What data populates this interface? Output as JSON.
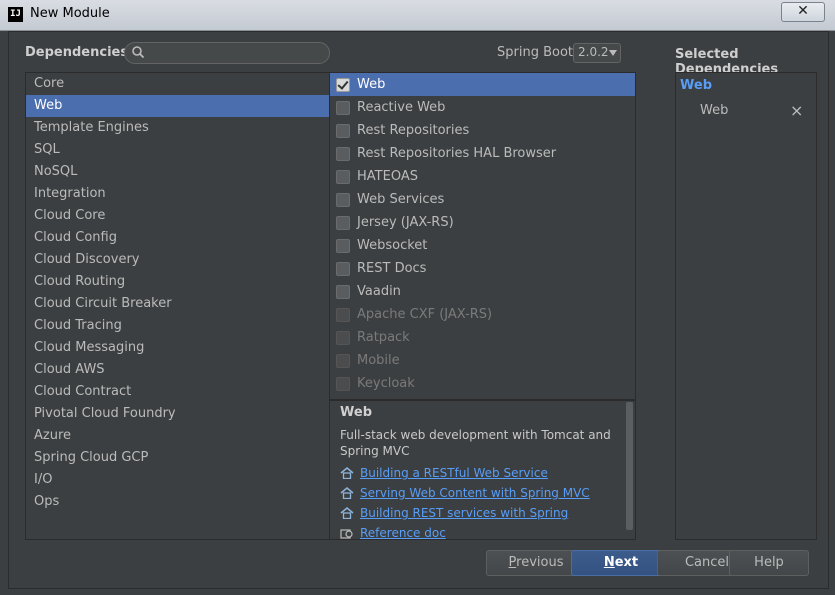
{
  "window": {
    "title": "New Module",
    "close_glyph": "✕",
    "app_icon": "IJ"
  },
  "header": {
    "dependencies_label": "Dependencies",
    "search": {
      "value": "",
      "placeholder": ""
    },
    "spring_boot_label": "Spring Boot",
    "spring_boot_version": "2.0.2",
    "selected_label": "Selected Dependencies"
  },
  "categories": [
    {
      "label": "Core"
    },
    {
      "label": "Web",
      "selected": true
    },
    {
      "label": "Template Engines"
    },
    {
      "label": "SQL"
    },
    {
      "label": "NoSQL"
    },
    {
      "label": "Integration"
    },
    {
      "label": "Cloud Core"
    },
    {
      "label": "Cloud Config"
    },
    {
      "label": "Cloud Discovery"
    },
    {
      "label": "Cloud Routing"
    },
    {
      "label": "Cloud Circuit Breaker"
    },
    {
      "label": "Cloud Tracing"
    },
    {
      "label": "Cloud Messaging"
    },
    {
      "label": "Cloud AWS"
    },
    {
      "label": "Cloud Contract"
    },
    {
      "label": "Pivotal Cloud Foundry"
    },
    {
      "label": "Azure"
    },
    {
      "label": "Spring Cloud GCP"
    },
    {
      "label": "I/O"
    },
    {
      "label": "Ops"
    }
  ],
  "dependencies": [
    {
      "label": "Web",
      "checked": true,
      "selected": true
    },
    {
      "label": "Reactive Web"
    },
    {
      "label": "Rest Repositories"
    },
    {
      "label": "Rest Repositories HAL Browser"
    },
    {
      "label": "HATEOAS"
    },
    {
      "label": "Web Services"
    },
    {
      "label": "Jersey (JAX-RS)"
    },
    {
      "label": "Websocket"
    },
    {
      "label": "REST Docs"
    },
    {
      "label": "Vaadin"
    },
    {
      "label": "Apache CXF (JAX-RS)",
      "disabled": true
    },
    {
      "label": "Ratpack",
      "disabled": true
    },
    {
      "label": "Mobile",
      "disabled": true
    },
    {
      "label": "Keycloak",
      "disabled": true
    }
  ],
  "description": {
    "title": "Web",
    "text": "Full-stack web development with Tomcat and Spring MVC",
    "links": [
      {
        "label": "Building a RESTful Web Service",
        "icon": "home-icon"
      },
      {
        "label": "Serving Web Content with Spring MVC",
        "icon": "home-icon"
      },
      {
        "label": "Building REST services with Spring",
        "icon": "home-icon"
      },
      {
        "label": "Reference doc",
        "icon": "reference-doc-icon"
      }
    ]
  },
  "selected": {
    "group": "Web",
    "items": [
      {
        "label": "Web",
        "remove_glyph": "×"
      }
    ]
  },
  "buttons": {
    "previous_mnemonic": "P",
    "previous_rest": "revious",
    "next_mnemonic": "N",
    "next_rest": "ext",
    "cancel": "Cancel",
    "help": "Help"
  },
  "colors": {
    "selection": "#4b6eaf",
    "link": "#589df6",
    "panel": "#3c3f41"
  }
}
